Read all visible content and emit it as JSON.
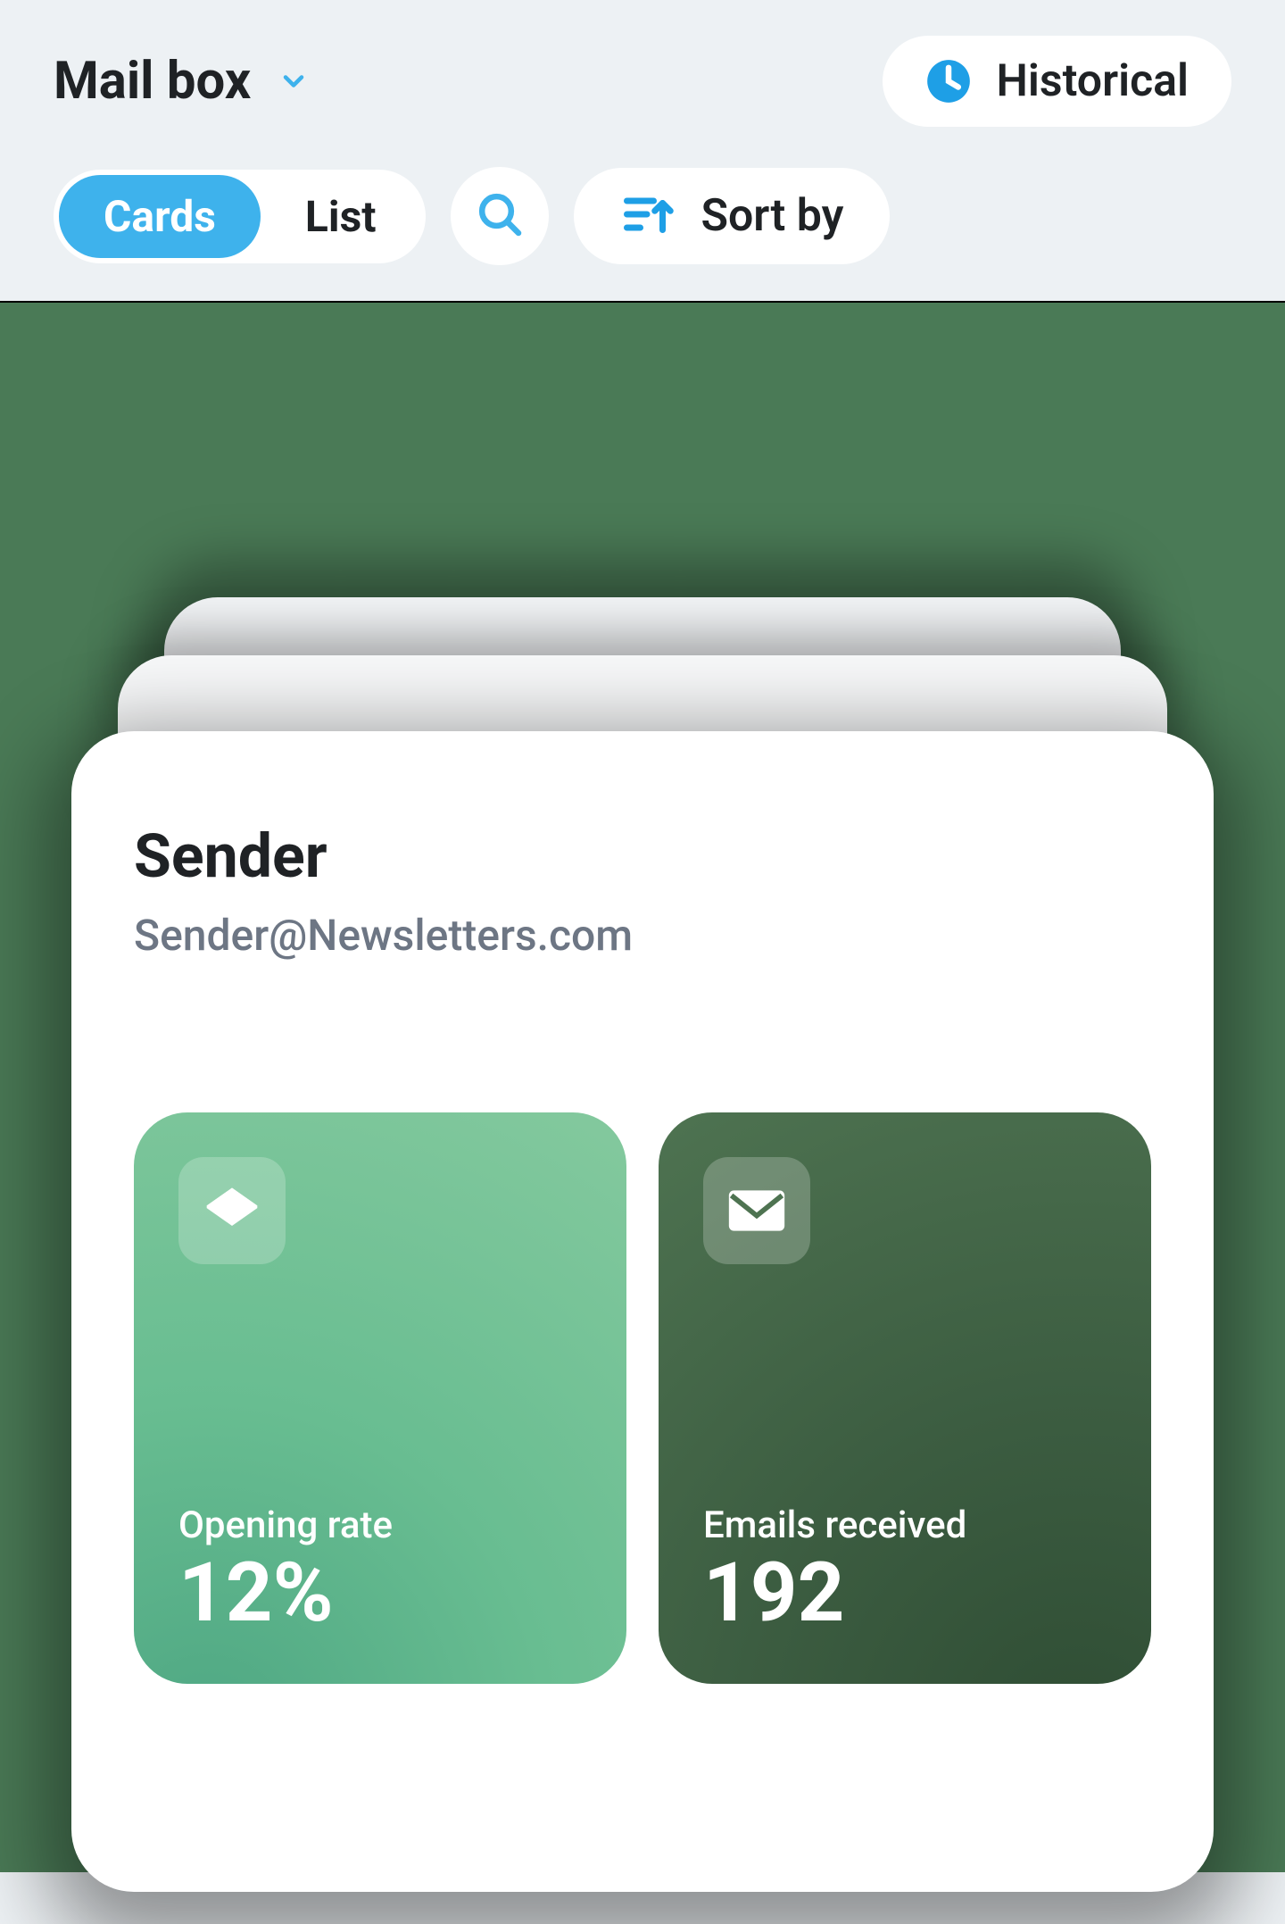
{
  "header": {
    "title": "Mail box",
    "historical_label": "Historical"
  },
  "toolbar": {
    "view_modes": [
      {
        "label": "Cards",
        "active": true
      },
      {
        "label": "List",
        "active": false
      }
    ],
    "sort_label": "Sort by"
  },
  "card": {
    "title": "Sender",
    "email": "Sender@Newsletters.com",
    "stats": [
      {
        "icon": "open-envelope",
        "label": "Opening rate",
        "value": "12%"
      },
      {
        "icon": "envelope",
        "label": "Emails received",
        "value": "192"
      }
    ]
  },
  "colors": {
    "accent": "#3eb2ec",
    "tile_light": "#68bd91",
    "tile_dark": "#3c5d41"
  }
}
